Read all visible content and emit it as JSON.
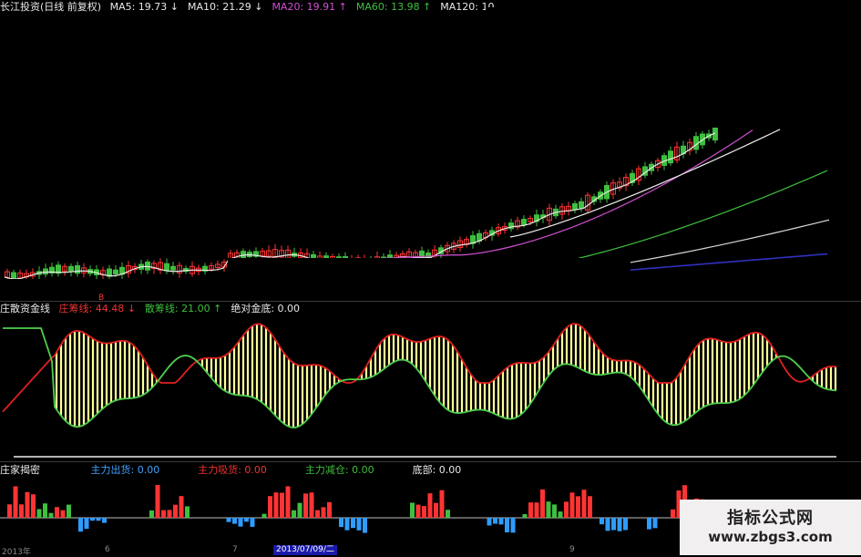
{
  "panel1": {
    "title": "长江投资(日线 前复权)",
    "ma": [
      {
        "label": "MA5: 19.73",
        "arrow": "↓",
        "color": "#e8e8e8"
      },
      {
        "label": "MA10: 21.29",
        "arrow": "↓",
        "color": "#e8e8e8"
      },
      {
        "label": "MA20: 19.91",
        "arrow": "↑",
        "color": "#d24fd2"
      },
      {
        "label": "MA60: 13.98",
        "arrow": "↑",
        "color": "#3fbf3f"
      },
      {
        "label": "MA120: 10.",
        "arrow": "",
        "color": "#e8e8e8"
      }
    ]
  },
  "panel2": {
    "title": "庄散资金线",
    "items": [
      {
        "label": "庄筹线: 44.48",
        "arrow": "↓",
        "color": "#e33"
      },
      {
        "label": "散筹线: 21.00",
        "arrow": "↑",
        "color": "#3fbf3f"
      },
      {
        "label": "绝对金底: 0.00",
        "arrow": "",
        "color": "#e8e8e8"
      }
    ]
  },
  "panel3": {
    "title": "庄家揭密",
    "items": [
      {
        "label": "主力出货: 0.00",
        "color": "#3fa0ff"
      },
      {
        "label": "主力吸货: 0.00",
        "color": "#e33"
      },
      {
        "label": "主力减仓: 0.00",
        "color": "#3fbf3f"
      },
      {
        "label": "底部: 0.00",
        "color": "#e8e8e8"
      }
    ]
  },
  "axis": {
    "labels": [
      "2013年",
      "6",
      "7",
      "9"
    ],
    "date_badge": "2013/07/09/二"
  },
  "watermark": {
    "line1": "指标公式网",
    "line2": "www.zbgs3.com"
  },
  "colors": {
    "up": "#ff3333",
    "down": "#3fbf3f",
    "ma5": "#e8e8e8",
    "ma20": "#d24fd2",
    "ma60": "#3fbf3f",
    "ma120": "#3030c0",
    "yellow": "#ffff99",
    "blue_bar": "#2e9cff"
  }
}
